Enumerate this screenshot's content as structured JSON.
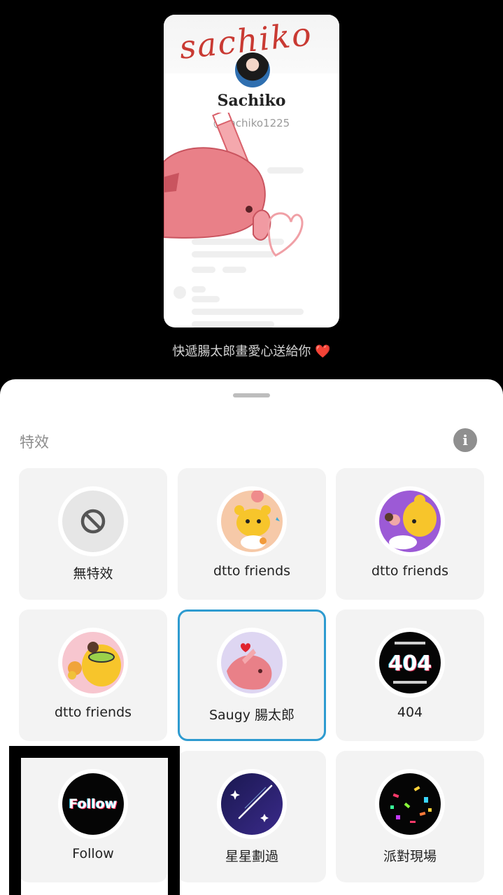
{
  "preview": {
    "banner_text": "sachiko",
    "profile_name": "Sachiko",
    "profile_handle": "@sachiko1225",
    "caption": "快遞腸太郎畫愛心送給你",
    "caption_emoji": "❤️"
  },
  "sheet": {
    "title": "特效",
    "info_icon": "info-icon",
    "effects": [
      {
        "label": "無特效",
        "icon": "no-effect-icon"
      },
      {
        "label": "dtto friends",
        "icon": "dtto-friends-1-thumbnail"
      },
      {
        "label": "dtto friends",
        "icon": "dtto-friends-2-thumbnail"
      },
      {
        "label": "dtto friends",
        "icon": "dtto-friends-3-thumbnail"
      },
      {
        "label": "Saugy 腸太郎",
        "icon": "saugy-thumbnail",
        "selected": true
      },
      {
        "label": "404",
        "icon": "404-thumbnail",
        "thumb_text": "404"
      },
      {
        "label": "Follow",
        "icon": "follow-thumbnail",
        "thumb_text": "Follow"
      },
      {
        "label": "星星劃過",
        "icon": "shooting-star-thumbnail"
      },
      {
        "label": "派對現場",
        "icon": "party-confetti-thumbnail"
      }
    ]
  },
  "colors": {
    "selected_border": "#2e9bd0",
    "tile_background": "#f3f3f3",
    "heart": "#e0242f"
  }
}
